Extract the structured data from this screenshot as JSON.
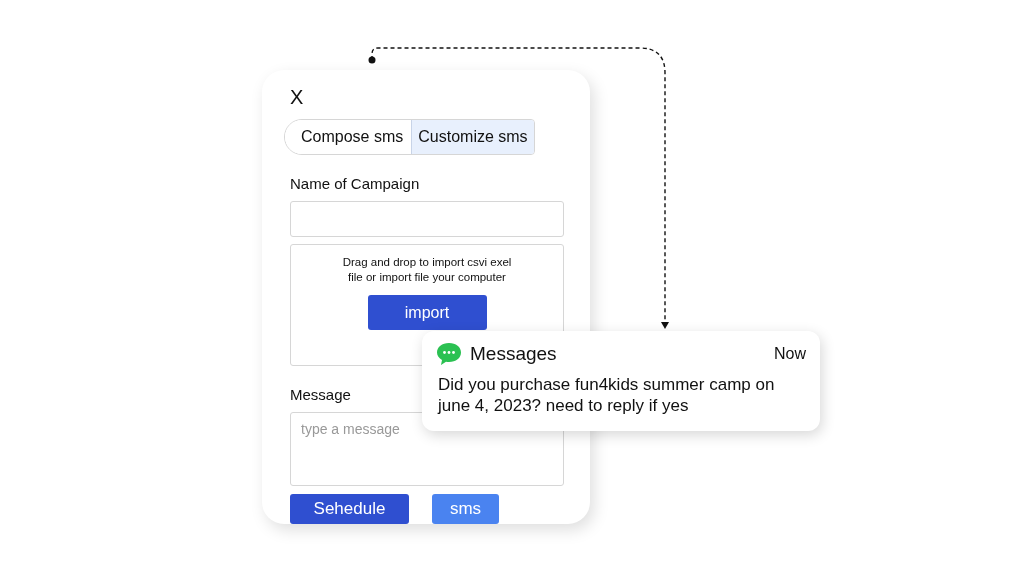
{
  "close": "X",
  "tabs": [
    {
      "label": "Compose sms",
      "selected": false
    },
    {
      "label": "Customize sms",
      "selected": true
    }
  ],
  "campaign": {
    "label": "Name of Campaign"
  },
  "dropzone": {
    "text": "Drag and drop to import csvi exel file or import file your computer",
    "button": "import"
  },
  "message": {
    "label": "Message",
    "placeholder": "type a message"
  },
  "buttons": [
    {
      "label": "Sehedule",
      "kind": "primary"
    },
    {
      "label": "sms",
      "kind": "secondary"
    }
  ],
  "notification": {
    "app": "Messages",
    "time": "Now",
    "text": "Did you purchase fun4kids summer camp on june 4, 2023? need to reply if yes"
  }
}
